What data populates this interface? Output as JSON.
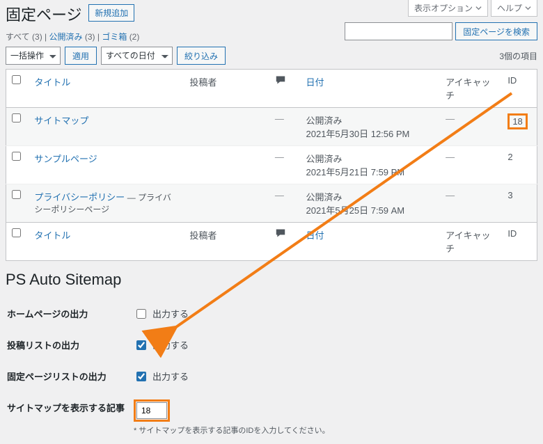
{
  "screen_options": {
    "display": "表示オプション",
    "help": "ヘルプ"
  },
  "header": {
    "title": "固定ページ",
    "add_new": "新規追加"
  },
  "filters": {
    "all": "すべて",
    "all_count": "(3)",
    "published": "公開済み",
    "published_count": "(3)",
    "trash": "ゴミ箱",
    "trash_count": "(2)"
  },
  "search": {
    "button": "固定ページを検索"
  },
  "bulk": {
    "action": "一括操作",
    "apply": "適用",
    "all_dates": "すべての日付",
    "filter": "絞り込み",
    "item_count": "3個の項目"
  },
  "cols": {
    "title": "タイトル",
    "author": "投稿者",
    "date": "日付",
    "thumb": "アイキャッチ",
    "id": "ID"
  },
  "rows": [
    {
      "title": "サイトマップ",
      "state": "",
      "comments": "—",
      "status": "公開済み",
      "datetime": "2021年5月30日 12:56 PM",
      "thumb": "—",
      "id": "18"
    },
    {
      "title": "サンプルページ",
      "state": "",
      "comments": "—",
      "status": "公開済み",
      "datetime": "2021年5月21日 7:59 PM",
      "thumb": "—",
      "id": "2"
    },
    {
      "title": "プライバシーポリシー",
      "state": "— プライバシーポリシーページ",
      "comments": "—",
      "status": "公開済み",
      "datetime": "2021年5月25日 7:59 AM",
      "thumb": "—",
      "id": "3"
    }
  ],
  "settings": {
    "title": "PS Auto Sitemap",
    "homepage_label": "ホームページの出力",
    "posts_label": "投稿リストの出力",
    "pages_label": "固定ページリストの出力",
    "display_post_label": "サイトマップを表示する記事",
    "output_text": "出力する",
    "homepage_checked": false,
    "posts_checked": true,
    "pages_checked": true,
    "display_post_id": "18",
    "display_post_desc": "* サイトマップを表示する記事のIDを入力してください。"
  }
}
